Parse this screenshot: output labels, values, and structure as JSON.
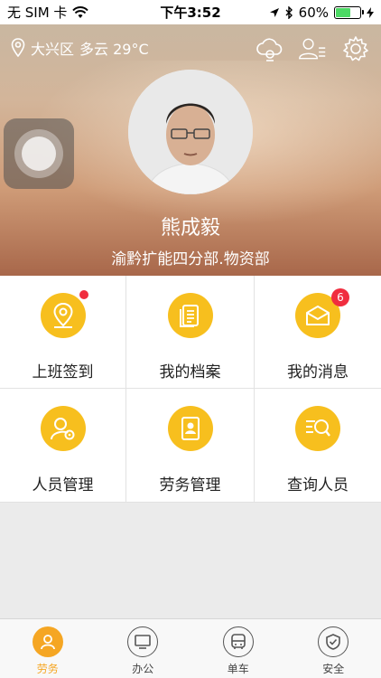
{
  "status_bar": {
    "carrier": "无 SIM 卡",
    "time": "下午3:52",
    "battery": "60%",
    "battery_level": 0.6
  },
  "header": {
    "location": "大兴区",
    "weather": "多云 29°C",
    "icons": [
      "cloud-camera-icon",
      "user-list-icon",
      "gear-icon"
    ],
    "user_name": "熊成毅",
    "department": "渝黔扩能四分部.物资部"
  },
  "grid": {
    "items": [
      {
        "label": "上班签到",
        "icon": "location-pin-icon",
        "dot": true
      },
      {
        "label": "我的档案",
        "icon": "document-icon"
      },
      {
        "label": "我的消息",
        "icon": "envelope-icon",
        "badge": "6"
      },
      {
        "label": "人员管理",
        "icon": "user-gear-icon"
      },
      {
        "label": "劳务管理",
        "icon": "contact-book-icon"
      },
      {
        "label": "查询人员",
        "icon": "search-list-icon"
      }
    ]
  },
  "tabbar": {
    "tabs": [
      {
        "label": "劳务",
        "icon": "person-icon",
        "active": true
      },
      {
        "label": "办公",
        "icon": "monitor-icon"
      },
      {
        "label": "单车",
        "icon": "bus-icon"
      },
      {
        "label": "安全",
        "icon": "shield-check-icon"
      }
    ]
  },
  "colors": {
    "accent": "#f5a623",
    "icon_bg": "#f7bf1e",
    "badge": "#f02d3f"
  }
}
